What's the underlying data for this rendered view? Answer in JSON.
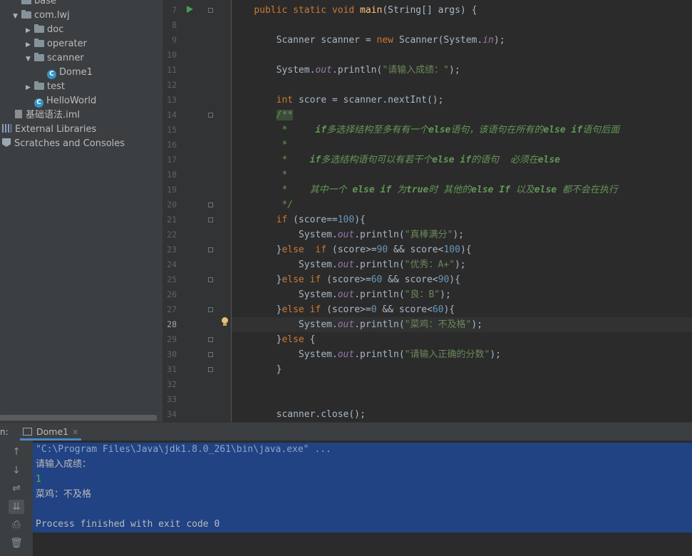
{
  "project_tree": {
    "items": [
      {
        "label": "base",
        "kind": "folder",
        "arrow": "",
        "indent": 1
      },
      {
        "label": "com.lwj",
        "kind": "folder",
        "arrow": "▼",
        "indent": 1
      },
      {
        "label": "doc",
        "kind": "folder",
        "arrow": "▶",
        "indent": 2
      },
      {
        "label": "operater",
        "kind": "folder",
        "arrow": "▶",
        "indent": 2
      },
      {
        "label": "scanner",
        "kind": "folder",
        "arrow": "▼",
        "indent": 2
      },
      {
        "label": "Dome1",
        "kind": "class",
        "arrow": "",
        "indent": 3
      },
      {
        "label": "test",
        "kind": "folder",
        "arrow": "▶",
        "indent": 2
      },
      {
        "label": "HelloWorld",
        "kind": "class",
        "arrow": "",
        "indent": 2
      },
      {
        "label": "基础语法.iml",
        "kind": "file",
        "arrow": "",
        "indent": 1
      },
      {
        "label": "External Libraries",
        "kind": "lib",
        "arrow": "",
        "indent": 0
      },
      {
        "label": "Scratches and Consoles",
        "kind": "scratch",
        "arrow": "",
        "indent": 0
      }
    ]
  },
  "editor": {
    "current_line": 28,
    "line_numbers": [
      "7",
      "8",
      "9",
      "10",
      "11",
      "12",
      "13",
      "14",
      "15",
      "16",
      "17",
      "18",
      "19",
      "20",
      "21",
      "22",
      "23",
      "24",
      "25",
      "26",
      "27",
      "28",
      "29",
      "30",
      "31",
      "32",
      "33",
      "34"
    ],
    "lines": [
      [
        {
          "t": "    "
        },
        {
          "t": "public static void ",
          "c": "kw"
        },
        {
          "t": "main",
          "c": "fn"
        },
        {
          "t": "(String[] args) {"
        }
      ],
      [],
      [
        {
          "t": "        Scanner scanner = "
        },
        {
          "t": "new ",
          "c": "kw"
        },
        {
          "t": "Scanner(System."
        },
        {
          "t": "in",
          "c": "fld"
        },
        {
          "t": ");"
        }
      ],
      [],
      [
        {
          "t": "        System."
        },
        {
          "t": "out",
          "c": "fld"
        },
        {
          "t": ".println("
        },
        {
          "t": "\"请输入成绩：\"",
          "c": "st"
        },
        {
          "t": ");"
        }
      ],
      [],
      [
        {
          "t": "        "
        },
        {
          "t": "int ",
          "c": "kw"
        },
        {
          "t": "score = scanner.nextInt();"
        }
      ],
      [
        {
          "t": "        "
        },
        {
          "t": "/**",
          "c": "dc hl"
        }
      ],
      [
        {
          "t": "         *     ",
          "c": "dc"
        },
        {
          "t": "if",
          "c": "dcs"
        },
        {
          "t": "多选择结构至多有有一个",
          "c": "dc"
        },
        {
          "t": "else",
          "c": "dcs"
        },
        {
          "t": "语句，该语句在所有的",
          "c": "dc"
        },
        {
          "t": "else if",
          "c": "dcs"
        },
        {
          "t": "语句后面",
          "c": "dc"
        }
      ],
      [
        {
          "t": "         *",
          "c": "dc"
        }
      ],
      [
        {
          "t": "         *    ",
          "c": "dc"
        },
        {
          "t": "if",
          "c": "dcs"
        },
        {
          "t": "多选结构语句可以有若干个",
          "c": "dc"
        },
        {
          "t": "else if",
          "c": "dcs"
        },
        {
          "t": "的语句  必须在",
          "c": "dc"
        },
        {
          "t": "else",
          "c": "dcs"
        }
      ],
      [
        {
          "t": "         *",
          "c": "dc"
        }
      ],
      [
        {
          "t": "         *    其中一个 ",
          "c": "dc"
        },
        {
          "t": "else if",
          "c": "dcs"
        },
        {
          "t": " 为",
          "c": "dc"
        },
        {
          "t": "true",
          "c": "dcs"
        },
        {
          "t": "时 其他的",
          "c": "dc"
        },
        {
          "t": "else If",
          "c": "dcs"
        },
        {
          "t": " 以及",
          "c": "dc"
        },
        {
          "t": "else",
          "c": "dcs"
        },
        {
          "t": " 都不会在执行",
          "c": "dc"
        }
      ],
      [
        {
          "t": "         */",
          "c": "dc"
        }
      ],
      [
        {
          "t": "        "
        },
        {
          "t": "if ",
          "c": "kw"
        },
        {
          "t": "(score=="
        },
        {
          "t": "100",
          "c": "nm"
        },
        {
          "t": "){"
        }
      ],
      [
        {
          "t": "            System."
        },
        {
          "t": "out",
          "c": "fld"
        },
        {
          "t": ".println("
        },
        {
          "t": "\"真棒满分\"",
          "c": "st"
        },
        {
          "t": ");"
        }
      ],
      [
        {
          "t": "        }"
        },
        {
          "t": "else  if ",
          "c": "kw"
        },
        {
          "t": "(score>="
        },
        {
          "t": "90",
          "c": "nm"
        },
        {
          "t": " && score<"
        },
        {
          "t": "100",
          "c": "nm"
        },
        {
          "t": "){"
        }
      ],
      [
        {
          "t": "            System."
        },
        {
          "t": "out",
          "c": "fld"
        },
        {
          "t": ".println("
        },
        {
          "t": "\"优秀：A+\"",
          "c": "st"
        },
        {
          "t": ");"
        }
      ],
      [
        {
          "t": "        }"
        },
        {
          "t": "else if ",
          "c": "kw"
        },
        {
          "t": "(score>="
        },
        {
          "t": "60",
          "c": "nm"
        },
        {
          "t": " && score<"
        },
        {
          "t": "90",
          "c": "nm"
        },
        {
          "t": "){"
        }
      ],
      [
        {
          "t": "            System."
        },
        {
          "t": "out",
          "c": "fld"
        },
        {
          "t": ".println("
        },
        {
          "t": "\"良：B\"",
          "c": "st"
        },
        {
          "t": ");"
        }
      ],
      [
        {
          "t": "        }"
        },
        {
          "t": "else if ",
          "c": "kw"
        },
        {
          "t": "(score>="
        },
        {
          "t": "0",
          "c": "nm"
        },
        {
          "t": " && score<"
        },
        {
          "t": "60",
          "c": "nm"
        },
        {
          "t": "){"
        }
      ],
      [
        {
          "t": "            System."
        },
        {
          "t": "out",
          "c": "fld"
        },
        {
          "t": ".println("
        },
        {
          "t": "\"菜鸡：不及格\"",
          "c": "st"
        },
        {
          "t": ");"
        }
      ],
      [
        {
          "t": "        }"
        },
        {
          "t": "else ",
          "c": "kw"
        },
        {
          "t": "{"
        }
      ],
      [
        {
          "t": "            System."
        },
        {
          "t": "out",
          "c": "fld"
        },
        {
          "t": ".println("
        },
        {
          "t": "\"请输入正确的分数\"",
          "c": "st"
        },
        {
          "t": ");"
        }
      ],
      [
        {
          "t": "        }"
        }
      ],
      [],
      [],
      [
        {
          "t": "        scanner.close();"
        }
      ]
    ]
  },
  "run_window": {
    "label": "n:",
    "tab_label": "Dome1",
    "tab_close": "✕",
    "console_lines": [
      {
        "text": "\"C:\\Program Files\\Java\\jdk1.8.0_261\\bin\\java.exe\" ...",
        "kind": "cmd"
      },
      {
        "text": "请输入成绩：",
        "kind": "out"
      },
      {
        "text": "1",
        "kind": "input"
      },
      {
        "text": "菜鸡：不及格",
        "kind": "out"
      },
      {
        "text": "",
        "kind": "out"
      },
      {
        "text": "Process finished with exit code 0",
        "kind": "out"
      }
    ],
    "tools": [
      {
        "name": "up-arrow-icon",
        "glyph": "↑"
      },
      {
        "name": "down-arrow-icon",
        "glyph": "↓"
      },
      {
        "name": "soft-wrap-icon",
        "glyph": "⇌"
      },
      {
        "name": "scroll-to-end-icon",
        "glyph": "⇊"
      },
      {
        "name": "print-icon",
        "glyph": "⎙"
      },
      {
        "name": "trash-icon",
        "glyph": "🗑"
      }
    ]
  },
  "colors": {
    "keyword": "#cc7832",
    "string": "#6a8759",
    "number": "#6897bb",
    "field": "#9876aa",
    "function": "#ffc66d",
    "doc_comment": "#629755",
    "selection": "#214283"
  }
}
